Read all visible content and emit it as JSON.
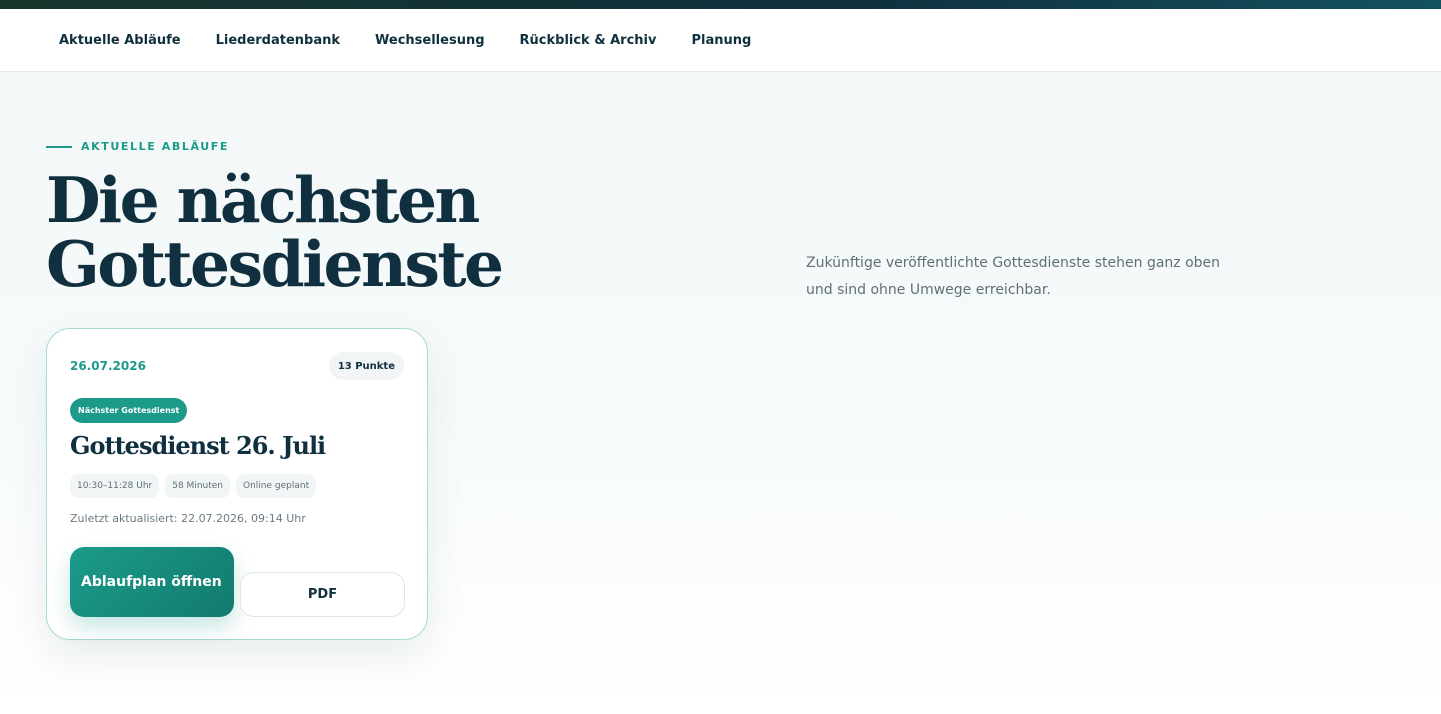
{
  "nav": {
    "items": [
      {
        "label": "Aktuelle Abläufe"
      },
      {
        "label": "Liederdatenbank"
      },
      {
        "label": "Wechsellesung"
      },
      {
        "label": "Rückblick & Archiv"
      },
      {
        "label": "Planung"
      }
    ]
  },
  "hero": {
    "eyebrow": "AKTUELLE ABLÄUFE",
    "title_line1": "Die nächsten",
    "title_line2": "Gottesdienste",
    "intro": "Zukünftige veröffentlichte Gottesdienste stehen ganz oben und sind ohne Umwege erreichbar."
  },
  "service_card": {
    "date": "26.07.2026",
    "points_badge": "13 Punkte",
    "status_badge": "Nächster Gottesdienst",
    "title": "Gottesdienst 26. Juli",
    "chips": [
      "10:30–11:28 Uhr",
      "58 Minuten",
      "Online geplant"
    ],
    "updated": "Zuletzt aktualisiert: 22.07.2026, 09:14 Uhr",
    "primary_button": "Ablaufplan öffnen",
    "secondary_button": "PDF"
  },
  "colors": {
    "accent": "#1c9b8a",
    "navy": "#10303f",
    "muted": "#5f6f78"
  }
}
